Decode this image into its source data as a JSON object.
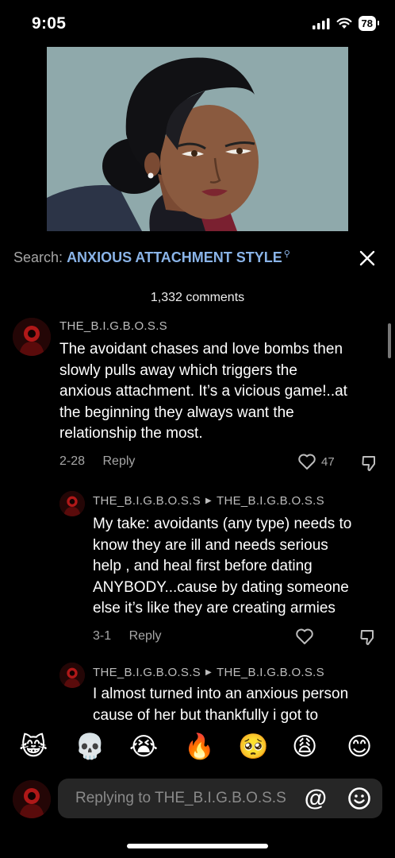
{
  "status": {
    "time": "9:05",
    "battery": "78"
  },
  "search": {
    "label": "Search:",
    "term": "ANXIOUS ATTACHMENT STYLE"
  },
  "comments_count": "1,332 comments",
  "comments": [
    {
      "username": "THE_B.I.G.B.O.S.S",
      "text_lines": [
        "The avoidant chases and love bombs then",
        "slowly pulls away which triggers the",
        "anxious attachment. It’s a vicious game!..at",
        "the beginning they always want the",
        "relationship the most."
      ],
      "date": "2-28",
      "reply_label": "Reply",
      "likes": "47"
    },
    {
      "username": "THE_B.I.G.B.O.S.S",
      "reply_to": "THE_B.I.G.B.O.S.S",
      "text_lines": [
        "My take: avoidants (any type) needs to",
        "know they are ill and needs serious",
        "help , and heal first before dating",
        "ANYBODY...cause by dating someone",
        "else it’s like they are creating armies"
      ],
      "date": "3-1",
      "reply_label": "Reply"
    },
    {
      "username": "THE_B.I.G.B.O.S.S",
      "reply_to": "THE_B.I.G.B.O.S.S",
      "text_lines": [
        "I almost turned into an anxious person",
        "cause of her but thankfully i got to"
      ]
    }
  ],
  "emojis": [
    "😹",
    "💀",
    "😭",
    "🔥",
    "🥺",
    "😩",
    "😊"
  ],
  "reply_input": {
    "placeholder": "Replying to THE_B.I.G.B.O.S.S",
    "at_label": "@"
  },
  "colors": {
    "background": "#000000",
    "search_term": "#8ab4e8",
    "muted": "#a6a6a6",
    "input_bg": "#262626"
  }
}
